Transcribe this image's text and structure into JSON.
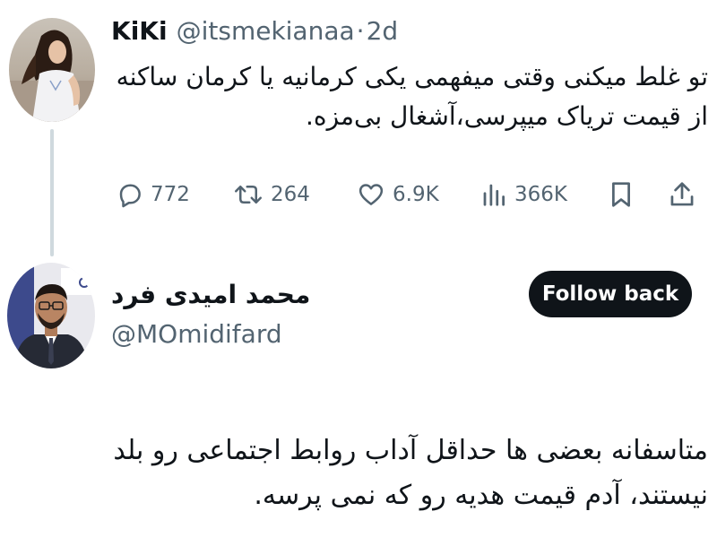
{
  "tweet1": {
    "display_name": "KiKi",
    "handle": "@itsmekianaa",
    "separator": "·",
    "time": "2d",
    "text_line1": "تو غلط میکنی وقتی میفهمی یکی کرمانیه یا کرمان ساکنه",
    "text_line2": "از قیمت تریاک میپرسی،آشغال بی‌مزه.",
    "stats": {
      "replies": "772",
      "retweets": "264",
      "likes": "6.9K",
      "views": "366K"
    },
    "icons": [
      "reply-icon",
      "retweet-icon",
      "like-icon",
      "views-icon",
      "bookmark-icon",
      "share-icon"
    ]
  },
  "reply_user": {
    "display_name": "محمد امیدی فرد",
    "handle": "@MOmidifard",
    "follow_label": "Follow back"
  },
  "tweet2": {
    "text_line1": "متاسفانه بعضی ها حداقل آداب روابط اجتماعی رو بلد",
    "text_line2": "نیستند، آدم قیمت هدیه رو که نمی پرسه."
  },
  "colors": {
    "text": "#0f1419",
    "secondary": "#536471",
    "thread_line": "#cfd9de",
    "button_bg": "#0f1419",
    "button_text": "#ffffff"
  }
}
